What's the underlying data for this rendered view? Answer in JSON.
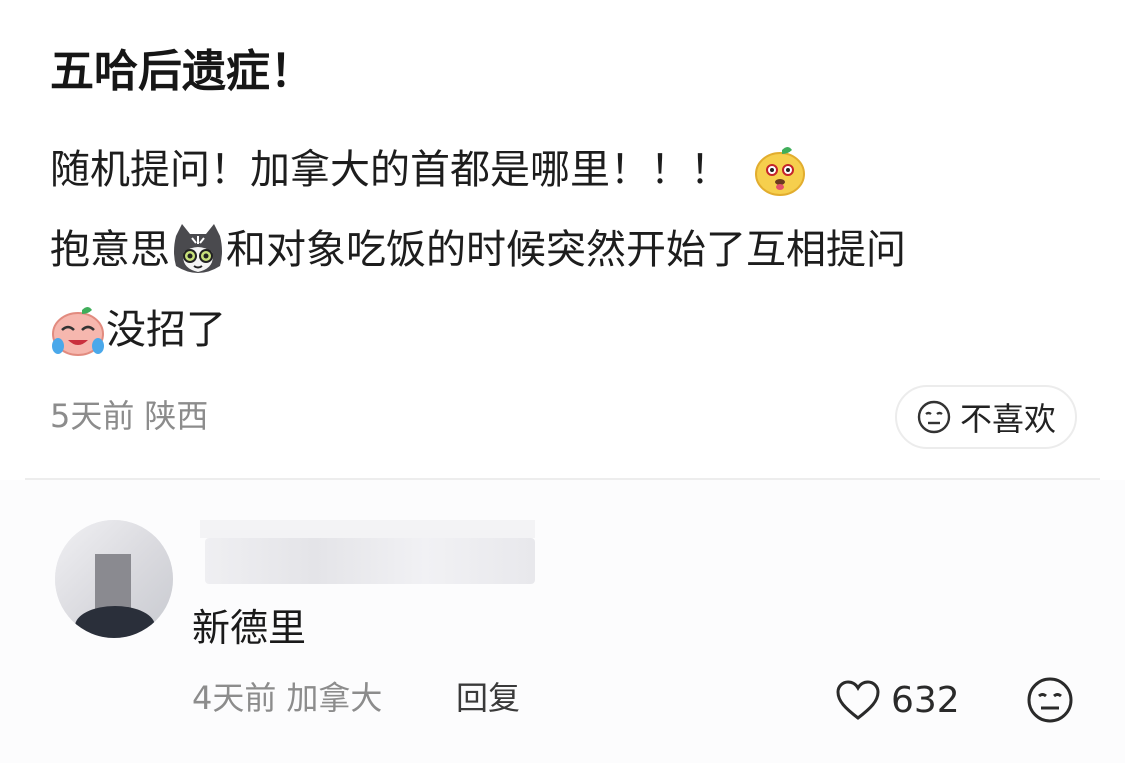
{
  "post": {
    "title": "五哈后遗症！",
    "body": {
      "line1_text": "随机提问！加拿大的首都是哪里！！！",
      "line1_emoji": "yellow-puppy-emoji",
      "line2_prefix": "抱意思",
      "line2_emoji": "cat-emoji",
      "line2_suffix": "和对象吃饭的时候突然开始了互相提问",
      "line3_emoji": "crying-laughing-emoji",
      "line3_text": "没招了"
    },
    "time": "5天前",
    "location": "陕西",
    "dislike_label": "不喜欢",
    "dislike_icon": "meh-face-icon"
  },
  "comment": {
    "text": "新德里",
    "time": "4天前",
    "location": "加拿大",
    "reply_label": "回复",
    "like_icon": "heart-icon",
    "like_count": "632",
    "dislike_icon": "meh-face-icon"
  },
  "colors": {
    "text": "#1d1d1d",
    "meta": "#8c8c8c",
    "divider": "#ededed"
  }
}
